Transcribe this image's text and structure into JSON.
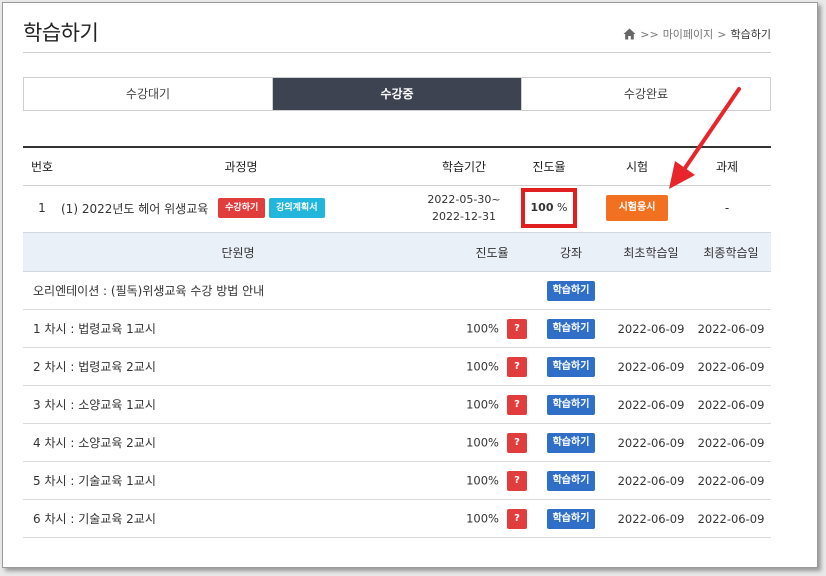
{
  "header": {
    "title": "학습하기",
    "breadcrumb": {
      "sep1": ">>",
      "mypage": "마이페이지",
      "sep2": ">",
      "current": "학습하기"
    }
  },
  "tabs": [
    {
      "label": "수강대기",
      "active": false
    },
    {
      "label": "수강중",
      "active": true
    },
    {
      "label": "수강완료",
      "active": false
    }
  ],
  "courses": {
    "headers": {
      "no": "번호",
      "name": "과정명",
      "period": "학습기간",
      "progress": "진도율",
      "exam": "시험",
      "assignment": "과제"
    },
    "row": {
      "no": "1",
      "name": "(1) 2022년도 헤어 위생교육",
      "badge_studying": "수강하기",
      "badge_plan": "강의계획서",
      "period_start": "2022-05-30~",
      "period_end": "2022-12-31",
      "progress_value": "100",
      "progress_unit": "%",
      "exam_button": "시험응시",
      "assignment": "-"
    }
  },
  "units": {
    "headers": {
      "name": "단원명",
      "progress": "진도율",
      "lecture": "강좌",
      "first": "최초학습일",
      "last": "최종학습일"
    },
    "rows": [
      {
        "name": "오리엔테이션 : (필독)위생교육 수강 방법 안내",
        "progress": "",
        "button": "학습하기",
        "first": "",
        "last": ""
      },
      {
        "name": "1 차시 : 법령교육 1교시",
        "progress": "100%",
        "button": "학습하기",
        "first": "2022-06-09",
        "last": "2022-06-09"
      },
      {
        "name": "2 차시 : 법령교육 2교시",
        "progress": "100%",
        "button": "학습하기",
        "first": "2022-06-09",
        "last": "2022-06-09"
      },
      {
        "name": "3 차시 : 소양교육 1교시",
        "progress": "100%",
        "button": "학습하기",
        "first": "2022-06-09",
        "last": "2022-06-09"
      },
      {
        "name": "4 차시 : 소양교육 2교시",
        "progress": "100%",
        "button": "학습하기",
        "first": "2022-06-09",
        "last": "2022-06-09"
      },
      {
        "name": "5 차시 : 기술교육 1교시",
        "progress": "100%",
        "button": "학습하기",
        "first": "2022-06-09",
        "last": "2022-06-09"
      },
      {
        "name": "6 차시 : 기술교육 2교시",
        "progress": "100%",
        "button": "학습하기",
        "first": "2022-06-09",
        "last": "2022-06-09"
      }
    ],
    "question_mark": "?"
  },
  "colors": {
    "tab_active": "#3d4350",
    "exam": "#f27121",
    "study": "#2f6fc8",
    "highlight": "#e02020"
  }
}
